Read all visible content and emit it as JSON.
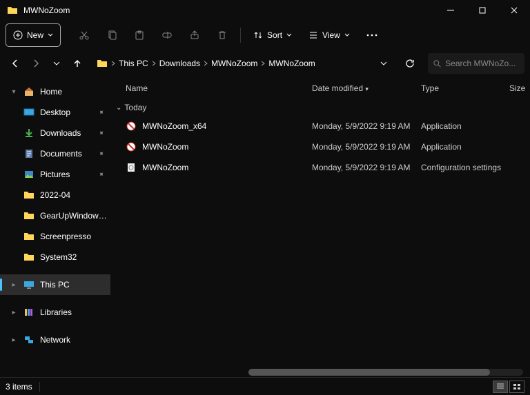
{
  "window": {
    "title": "MWNoZoom"
  },
  "toolbar": {
    "new_label": "New",
    "sort_label": "Sort",
    "view_label": "View"
  },
  "breadcrumb": {
    "items": [
      "This PC",
      "Downloads",
      "MWNoZoom",
      "MWNoZoom"
    ]
  },
  "search": {
    "placeholder": "Search MWNoZo..."
  },
  "sidebar": {
    "home": "Home",
    "quick": [
      {
        "label": "Desktop"
      },
      {
        "label": "Downloads"
      },
      {
        "label": "Documents"
      },
      {
        "label": "Pictures"
      },
      {
        "label": "2022-04"
      },
      {
        "label": "GearUpWindows D"
      },
      {
        "label": "Screenpresso"
      },
      {
        "label": "System32"
      }
    ],
    "thispc": "This PC",
    "libraries": "Libraries",
    "network": "Network"
  },
  "columns": {
    "name": "Name",
    "date": "Date modified",
    "type": "Type",
    "size": "Size"
  },
  "groups": [
    {
      "label": "Today",
      "files": [
        {
          "name": "MWNoZoom_x64",
          "date": "Monday, 5/9/2022 9:19 AM",
          "type": "Application",
          "icon": "exe"
        },
        {
          "name": "MWNoZoom",
          "date": "Monday, 5/9/2022 9:19 AM",
          "type": "Application",
          "icon": "exe"
        },
        {
          "name": "MWNoZoom",
          "date": "Monday, 5/9/2022 9:19 AM",
          "type": "Configuration settings",
          "icon": "ini"
        }
      ]
    }
  ],
  "status": {
    "count": "3 items"
  }
}
